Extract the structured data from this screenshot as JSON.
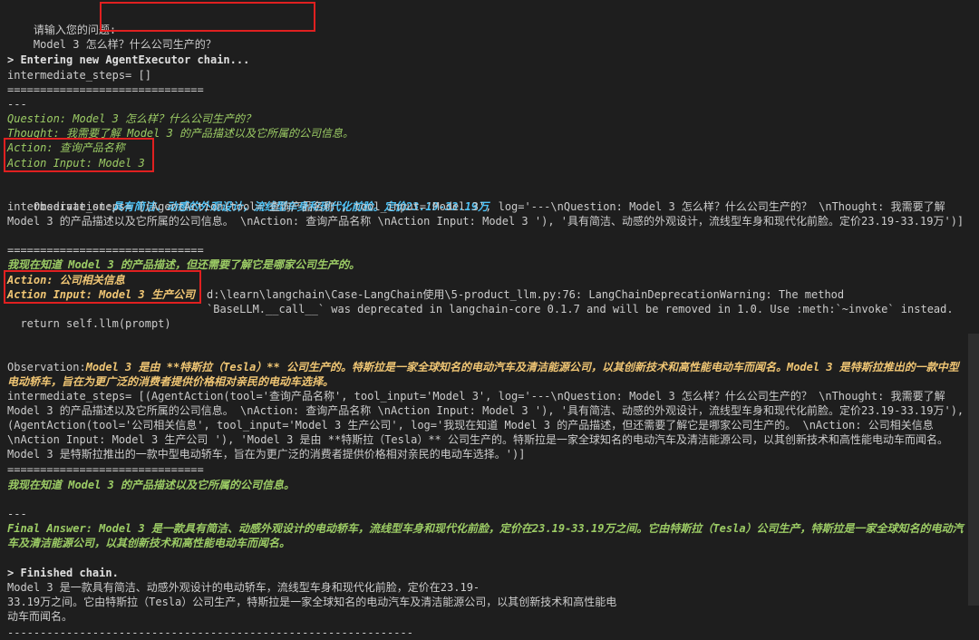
{
  "lines": {
    "top_rule": "--------------------------------------------------------------",
    "prompt_label": "请输入您的问题:",
    "prompt_value": "Model 3 怎么样？什么公司生产的？",
    "entering": "> Entering new AgentExecutor chain...",
    "steps_empty": "intermediate_steps= []",
    "sep1": "==============================",
    "dashes1": "---",
    "question": "Question: Model 3 怎么样？什么公司生产的？",
    "thought": "Thought: 我需要了解 Model 3 的产品描述以及它所属的公司信息。",
    "action1": "Action: 查询产品名称",
    "action_input1": "Action Input: Model 3",
    "obs1_label": "Observation:",
    "obs1_value": "具有简洁、动感的外观设计，流线型车身和现代化前脸。定价23.19-33.19万",
    "steps1": "intermediate_steps= [(AgentAction(tool='查询产品名称', tool_input='Model 3', log='---\\nQuestion: Model 3 怎么样？什么公司生产的？  \\nThought: 我需要了解 Model 3 的产品描述以及它所属的公司信息。  \\nAction: 查询产品名称  \\nAction Input: Model 3  '), '具有简洁、动感的外观设计，流线型车身和现代化前脸。定价23.19-33.19万')]",
    "sep2": "==============================",
    "thought2": "我现在知道 Model 3 的产品描述，但还需要了解它是哪家公司生产的。",
    "action2": "Action: 公司相关信息",
    "action_input2": "Action Input: Model 3 生产公司",
    "warning": "d:\\learn\\langchain\\Case-LangChain使用\\5-product_llm.py:76: LangChainDeprecationWarning: The method `BaseLLM.__call__` was deprecated in langchain-core 0.1.7 and will be removed in 1.0. Use :meth:`~invoke` instead.",
    "return_line": "  return self.llm(prompt)",
    "obs2_label": "Observation:",
    "obs2_value": "Model 3 是由 **特斯拉（Tesla）** 公司生产的。特斯拉是一家全球知名的电动汽车及清洁能源公司，以其创新技术和高性能电动车而闻名。Model 3 是特斯拉推出的一款中型电动轿车，旨在为更广泛的消费者提供价格相对亲民的电动车选择。",
    "steps2": "intermediate_steps= [(AgentAction(tool='查询产品名称', tool_input='Model 3', log='---\\nQuestion: Model 3 怎么样？什么公司生产的？  \\nThought: 我需要了解 Model 3 的产品描述以及它所属的公司信息。  \\nAction: 查询产品名称  \\nAction Input: Model 3  '), '具有简洁、动感的外观设计，流线型车身和现代化前脸。定价23.19-33.19万'), (AgentAction(tool='公司相关信息', tool_input='Model 3 生产公司', log='我现在知道 Model 3 的产品描述，但还需要了解它是哪家公司生产的。  \\nAction: 公司相关信息  \\nAction Input: Model 3 生产公司  '), 'Model 3 是由 **特斯拉（Tesla）** 公司生产的。特斯拉是一家全球知名的电动汽车及清洁能源公司，以其创新技术和高性能电动车而闻名。Model 3 是特斯拉推出的一款中型电动轿车，旨在为更广泛的消费者提供价格相对亲民的电动车选择。')]",
    "sep3": "==============================",
    "thought3": "我现在知道 Model 3 的产品描述以及它所属的公司信息。",
    "dashes2": "---",
    "final_answer": "Final Answer: Model 3 是一款具有简洁、动感外观设计的电动轿车，流线型车身和现代化前脸，定价在23.19-33.19万之间。它由特斯拉（Tesla）公司生产，特斯拉是一家全球知名的电动汽车及清洁能源公司，以其创新技术和高性能电动车而闻名。",
    "finished": "> Finished chain.",
    "result1": "Model 3 是一款具有简洁、动感外观设计的电动轿车，流线型车身和现代化前脸，定价在23.19-",
    "result2": "33.19万之间。它由特斯拉（Tesla）公司生产，特斯拉是一家全球知名的电动汽车及清洁能源公司，以其创新技术和高性能电",
    "result3": "动车而闻名。",
    "bottom_rule": "--------------------------------------------------------------"
  }
}
